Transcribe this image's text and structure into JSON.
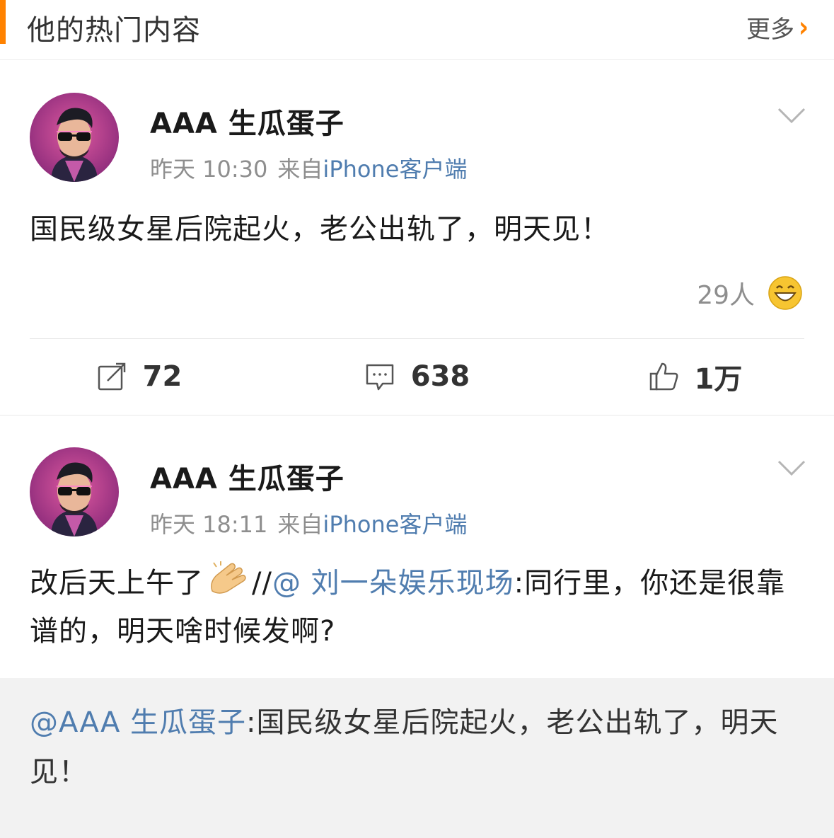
{
  "section": {
    "title": "他的热门内容",
    "more_label": "更多"
  },
  "colors": {
    "accent": "#ff8200",
    "link": "#507daf",
    "meta_gray": "#8e8e8e"
  },
  "posts": [
    {
      "username": "AAA 生瓜蛋子",
      "time": "昨天 10:30",
      "source_prefix": "来自",
      "source_client": "iPhone客户端",
      "text": "国民级女星后院起火，老公出轨了，明天见！",
      "reactions": {
        "count": "29人",
        "emoji": "grinning-face-icon"
      },
      "actions": [
        {
          "icon": "repost-icon",
          "count": "72"
        },
        {
          "icon": "comment-icon",
          "count": "638"
        },
        {
          "icon": "like-icon",
          "count": "1万"
        }
      ]
    },
    {
      "username": "AAA 生瓜蛋子",
      "time": "昨天 18:11",
      "source_prefix": "来自",
      "source_client": "iPhone客户端",
      "text_part1": "改后天上午了",
      "emoji": "clapping-hands-icon",
      "repost_sep": "//",
      "mention": "@ 刘一朵娱乐现场",
      "text_part2": ":同行里，你还是很靠谱的，明天啥时候发啊?",
      "quoted": {
        "mention": "@AAA 生瓜蛋子",
        "text": ":国民级女星后院起火，老公出轨了，明天见！"
      }
    }
  ]
}
